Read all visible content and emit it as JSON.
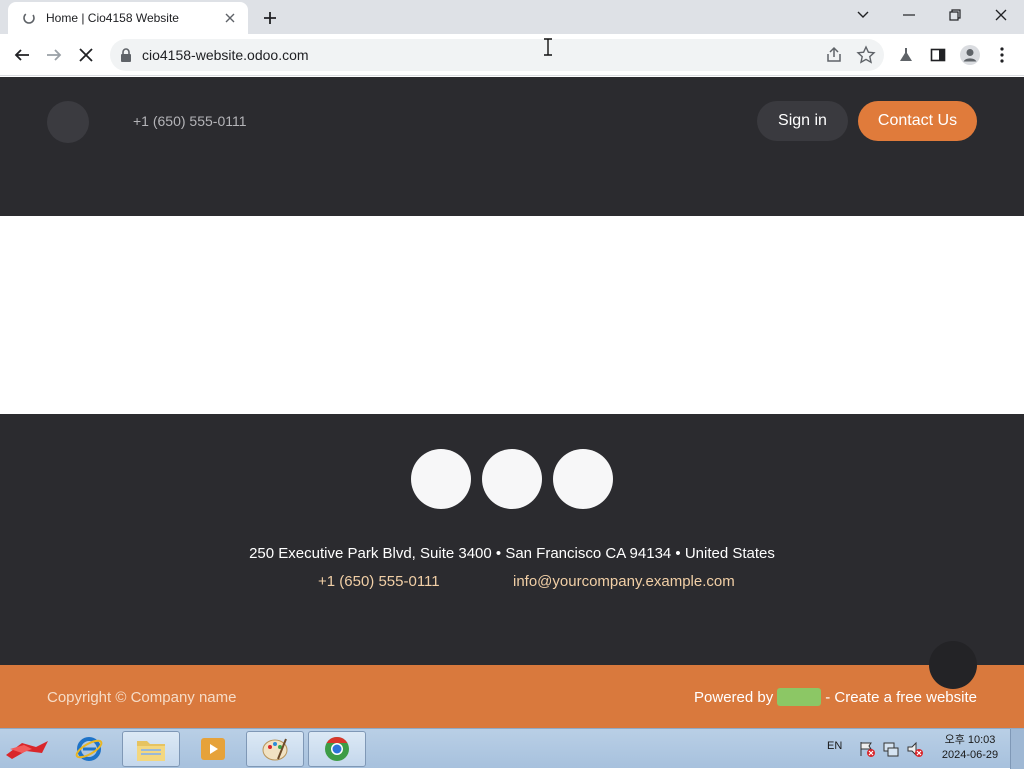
{
  "browser": {
    "tab_title": "Home | Cio4158 Website",
    "url": "cio4158-website.odoo.com"
  },
  "header": {
    "phone": "+1 (650) 555-0111",
    "sign_in_label": "Sign in",
    "contact_label": "Contact Us"
  },
  "footer": {
    "address": "250 Executive Park Blvd, Suite 3400 • San Francisco CA 94134 • United States",
    "phone": "+1 (650) 555-0111",
    "email": "info@yourcompany.example.com"
  },
  "copyright": {
    "text": "Copyright © Company name",
    "powered_prefix": "Powered by",
    "powered_suffix": "- Create a free website"
  },
  "taskbar": {
    "language": "EN",
    "time": "오후 10:03",
    "date": "2024-06-29"
  },
  "colors": {
    "header_bg": "#2b2b2f",
    "accent_orange": "#e07b3b",
    "footer_link": "#f1cfa6",
    "odoo_green": "#8cc765"
  }
}
